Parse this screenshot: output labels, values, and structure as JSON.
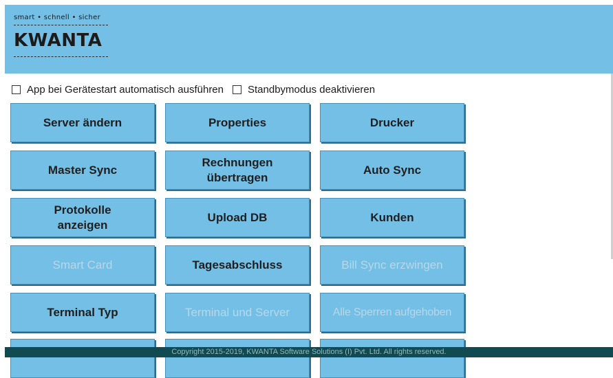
{
  "header": {
    "tagline": "smart • schnell • sicher",
    "logo": "KWANTA"
  },
  "options": [
    {
      "label": "App bei Gerätestart automatisch ausführen",
      "checked": false
    },
    {
      "label": "Standbymodus deaktivieren",
      "checked": false
    }
  ],
  "buttons": {
    "server_aendern": {
      "label": "Server ändern",
      "enabled": true
    },
    "properties": {
      "label": "Properties",
      "enabled": true
    },
    "drucker": {
      "label": "Drucker",
      "enabled": true
    },
    "master_sync": {
      "label": "Master Sync",
      "enabled": true
    },
    "rechnungen": {
      "label": "Rechnungen\nübertragen",
      "enabled": true
    },
    "auto_sync": {
      "label": "Auto Sync",
      "enabled": true
    },
    "protokolle": {
      "label": "Protokolle\nanzeigen",
      "enabled": true
    },
    "upload_db": {
      "label": "Upload DB",
      "enabled": true
    },
    "kunden": {
      "label": "Kunden",
      "enabled": true
    },
    "smart_card": {
      "label": "Smart Card",
      "enabled": false
    },
    "tagesabschluss": {
      "label": "Tagesabschluss",
      "enabled": true
    },
    "bill_sync": {
      "label": "Bill Sync erzwingen",
      "enabled": false
    },
    "terminal_typ": {
      "label": "Terminal Typ",
      "enabled": true
    },
    "terminal_server": {
      "label": "Terminal und Server",
      "enabled": false
    },
    "sperren": {
      "label": "Alle Sperren aufgehoben",
      "enabled": false
    }
  },
  "footer": {
    "copyright": "Copyright 2015-2019, KWANTA Software Solutions (I) Pvt. Ltd. All rights reserved."
  },
  "colors": {
    "accent": "#74bfe6",
    "footer_bg": "#124a52",
    "disabled_text": "#b9d7e8"
  }
}
